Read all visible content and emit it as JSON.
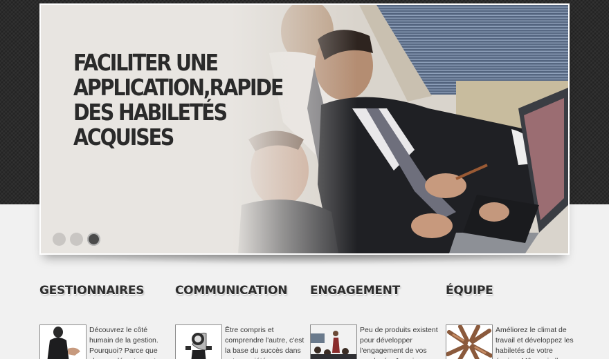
{
  "slider": {
    "headline_lines": [
      "Faciliter une",
      "application,rapide",
      "des habiletés",
      "acquises"
    ],
    "dots": [
      {
        "state": "inactive"
      },
      {
        "state": "inactive"
      },
      {
        "state": "active"
      }
    ]
  },
  "features": [
    {
      "title": "Gestionnaires",
      "icon": "business-handshake-image",
      "text": "Découvrez le côté humain de la gestion. Pourquoi? Parce que chaque département"
    },
    {
      "title": "Communication",
      "icon": "megaphone-person-image",
      "text": "Être compris et comprendre l'autre, c'est la base du succès dans votre société"
    },
    {
      "title": "Engagement",
      "icon": "audience-presentation-image",
      "text": "Peu de produits existent pour développer l'engagement de vos employés. Je suis une"
    },
    {
      "title": "Équipe",
      "icon": "team-hands-circle-image",
      "text": "Améliorez le climat de travail et développez les habiletés de votre équipe. Même si elle"
    }
  ],
  "colors": {
    "top_band": "#2b2b2b",
    "page_background": "#f1f1f1",
    "heading_text": "#2d2d2d",
    "active_dot": "#4b4b4b",
    "inactive_dot": "#c9c6c3"
  }
}
